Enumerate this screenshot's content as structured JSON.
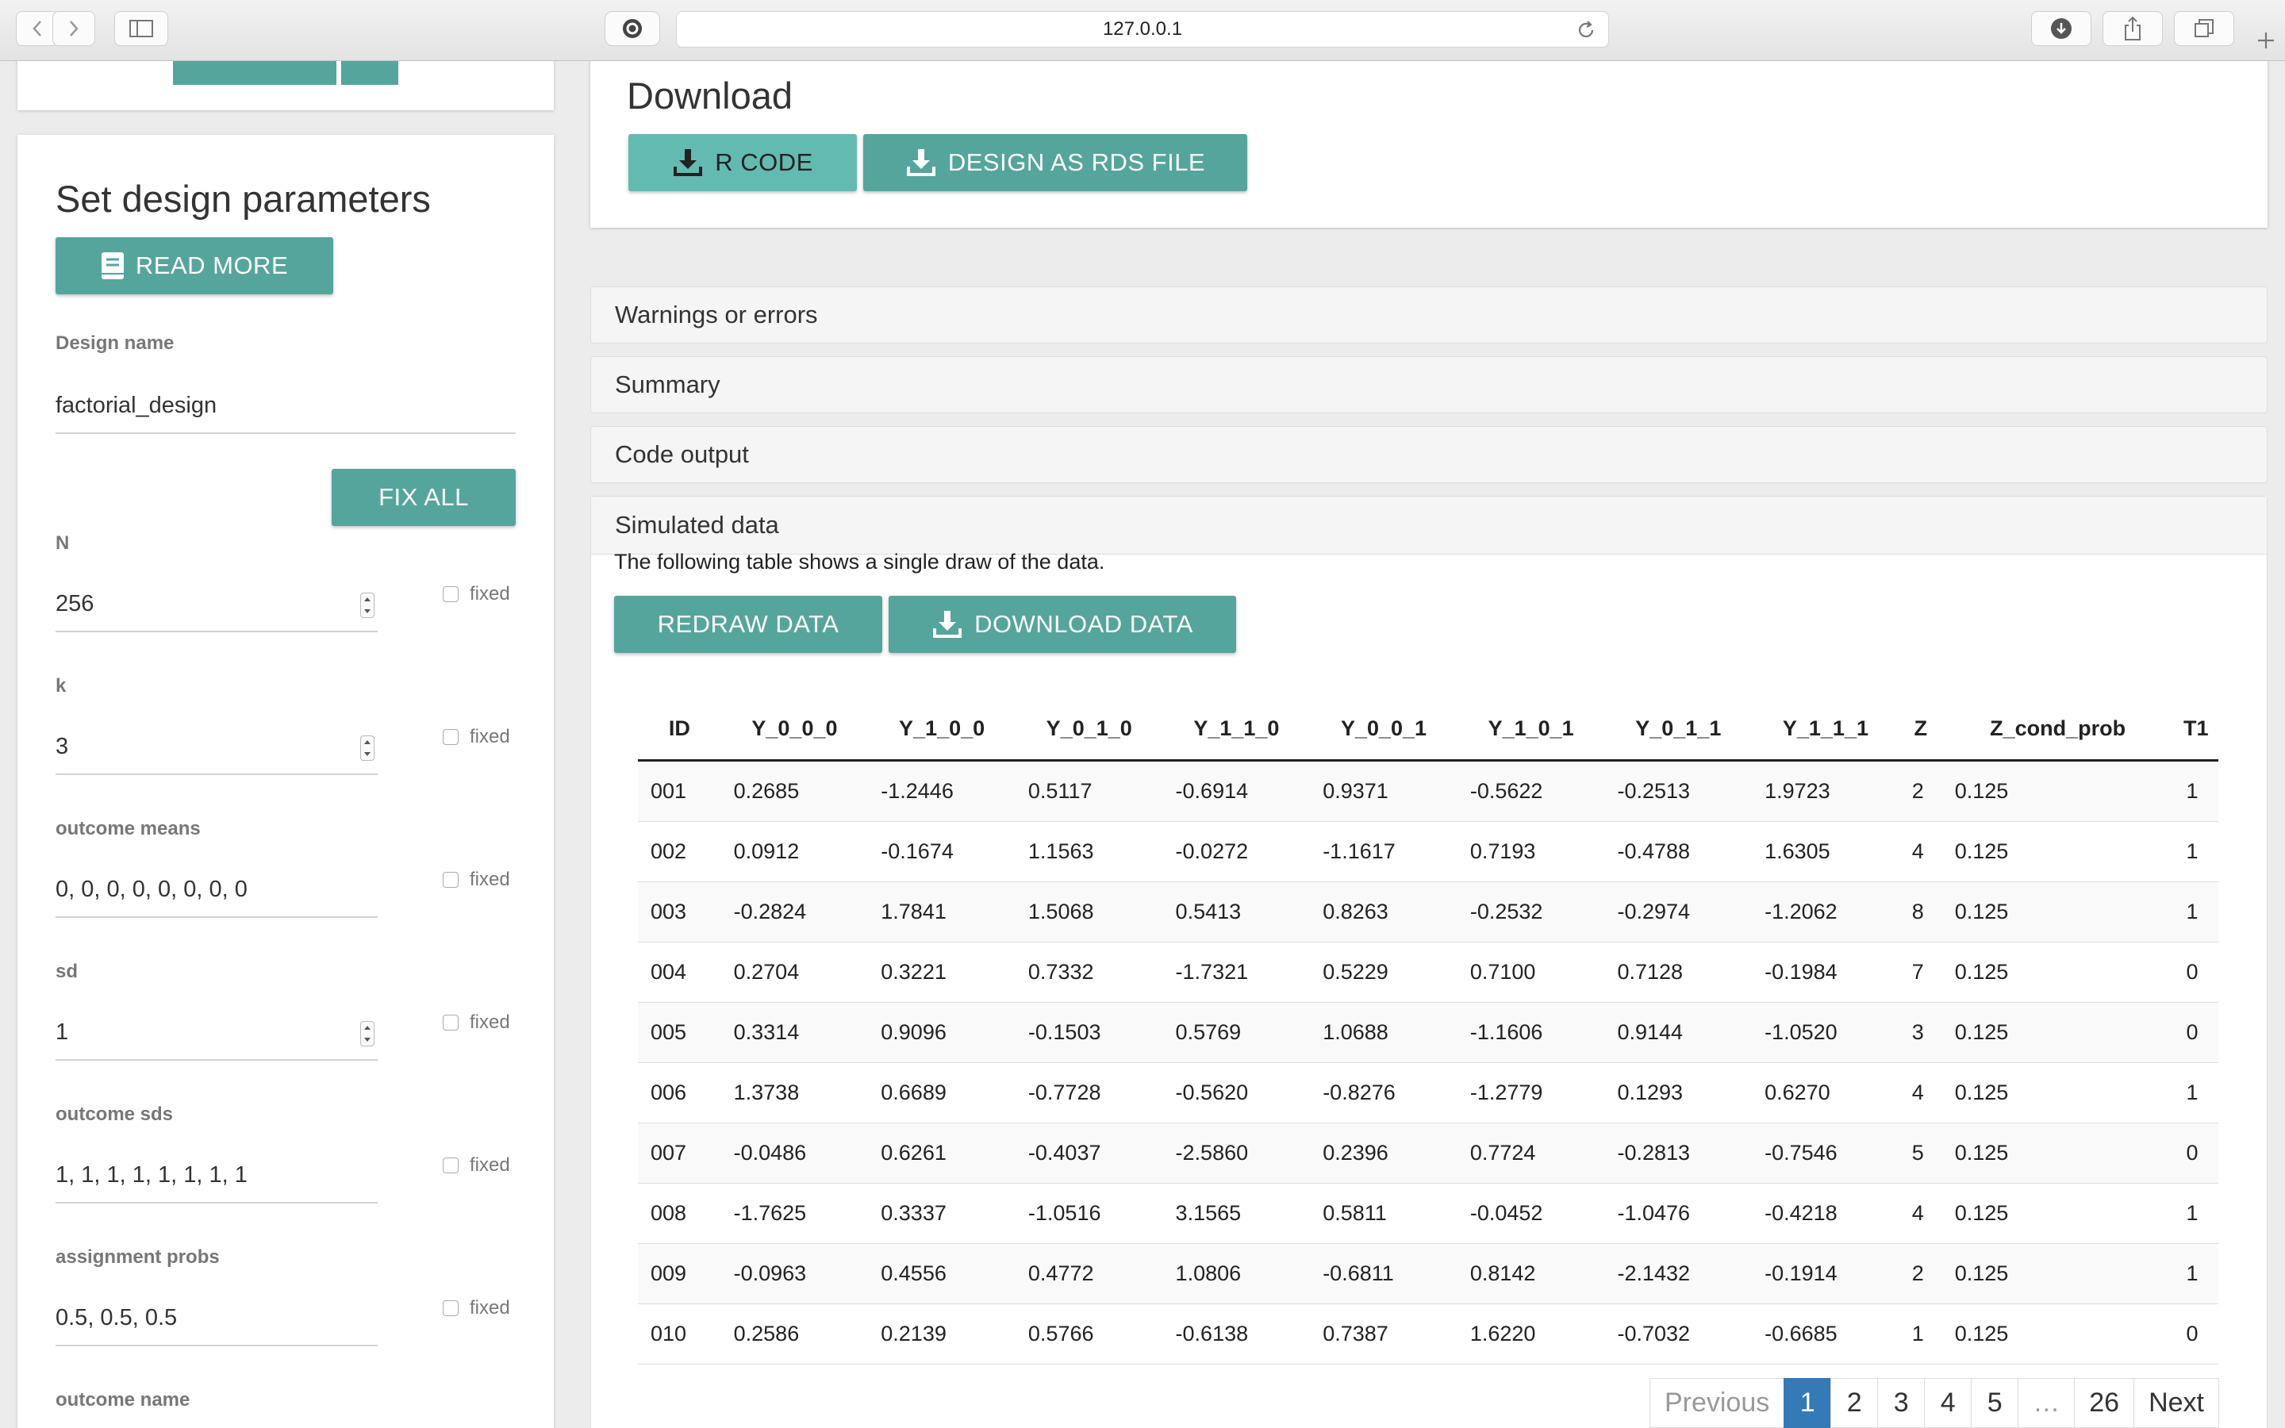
{
  "browser": {
    "url": "127.0.0.1"
  },
  "sidebar": {
    "title": "Set design parameters",
    "read_more": "READ MORE",
    "design_name_label": "Design name",
    "design_name_value": "factorial_design",
    "fix_all": "FIX ALL",
    "fixed_label": "fixed",
    "fields": [
      {
        "label": "N",
        "value": "256"
      },
      {
        "label": "k",
        "value": "3"
      },
      {
        "label": "outcome means",
        "value": "0, 0, 0, 0, 0, 0, 0, 0"
      },
      {
        "label": "sd",
        "value": "1"
      },
      {
        "label": "outcome sds",
        "value": "1, 1, 1, 1, 1, 1, 1, 1"
      },
      {
        "label": "assignment probs",
        "value": "0.5, 0.5, 0.5"
      },
      {
        "label": "outcome name",
        "value": ""
      }
    ]
  },
  "download": {
    "title": "Download",
    "r_code": "R CODE",
    "rds": "DESIGN AS RDS FILE"
  },
  "panels": {
    "warnings": "Warnings or errors",
    "summary": "Summary",
    "code_output": "Code output",
    "simulated": "Simulated data"
  },
  "simulated": {
    "caption": "The following table shows a single draw of the data.",
    "redraw": "REDRAW DATA",
    "download": "DOWNLOAD DATA"
  },
  "table": {
    "columns": [
      "ID",
      "Y_0_0_0",
      "Y_1_0_0",
      "Y_0_1_0",
      "Y_1_1_0",
      "Y_0_0_1",
      "Y_1_0_1",
      "Y_0_1_1",
      "Y_1_1_1",
      "Z",
      "Z_cond_prob",
      "T1"
    ],
    "rows": [
      [
        "001",
        "0.2685",
        "-1.2446",
        "0.5117",
        "-0.6914",
        "0.9371",
        "-0.5622",
        "-0.2513",
        "1.9723",
        "2",
        "0.125",
        "1"
      ],
      [
        "002",
        "0.0912",
        "-0.1674",
        "1.1563",
        "-0.0272",
        "-1.1617",
        "0.7193",
        "-0.4788",
        "1.6305",
        "4",
        "0.125",
        "1"
      ],
      [
        "003",
        "-0.2824",
        "1.7841",
        "1.5068",
        "0.5413",
        "0.8263",
        "-0.2532",
        "-0.2974",
        "-1.2062",
        "8",
        "0.125",
        "1"
      ],
      [
        "004",
        "0.2704",
        "0.3221",
        "0.7332",
        "-1.7321",
        "0.5229",
        "0.7100",
        "0.7128",
        "-0.1984",
        "7",
        "0.125",
        "0"
      ],
      [
        "005",
        "0.3314",
        "0.9096",
        "-0.1503",
        "0.5769",
        "1.0688",
        "-1.1606",
        "0.9144",
        "-1.0520",
        "3",
        "0.125",
        "0"
      ],
      [
        "006",
        "1.3738",
        "0.6689",
        "-0.7728",
        "-0.5620",
        "-0.8276",
        "-1.2779",
        "0.1293",
        "0.6270",
        "4",
        "0.125",
        "1"
      ],
      [
        "007",
        "-0.0486",
        "0.6261",
        "-0.4037",
        "-2.5860",
        "0.2396",
        "0.7724",
        "-0.2813",
        "-0.7546",
        "5",
        "0.125",
        "0"
      ],
      [
        "008",
        "-1.7625",
        "0.3337",
        "-1.0516",
        "3.1565",
        "0.5811",
        "-0.0452",
        "-1.0476",
        "-0.4218",
        "4",
        "0.125",
        "1"
      ],
      [
        "009",
        "-0.0963",
        "0.4556",
        "0.4772",
        "1.0806",
        "-0.6811",
        "0.8142",
        "-2.1432",
        "-0.1914",
        "2",
        "0.125",
        "1"
      ],
      [
        "010",
        "0.2586",
        "0.2139",
        "0.5766",
        "-0.6138",
        "0.7387",
        "1.6220",
        "-0.7032",
        "-0.6685",
        "1",
        "0.125",
        "0"
      ]
    ]
  },
  "pagination": {
    "previous": "Previous",
    "pages": [
      "1",
      "2",
      "3",
      "4",
      "5",
      "…",
      "26"
    ],
    "next": "Next"
  }
}
